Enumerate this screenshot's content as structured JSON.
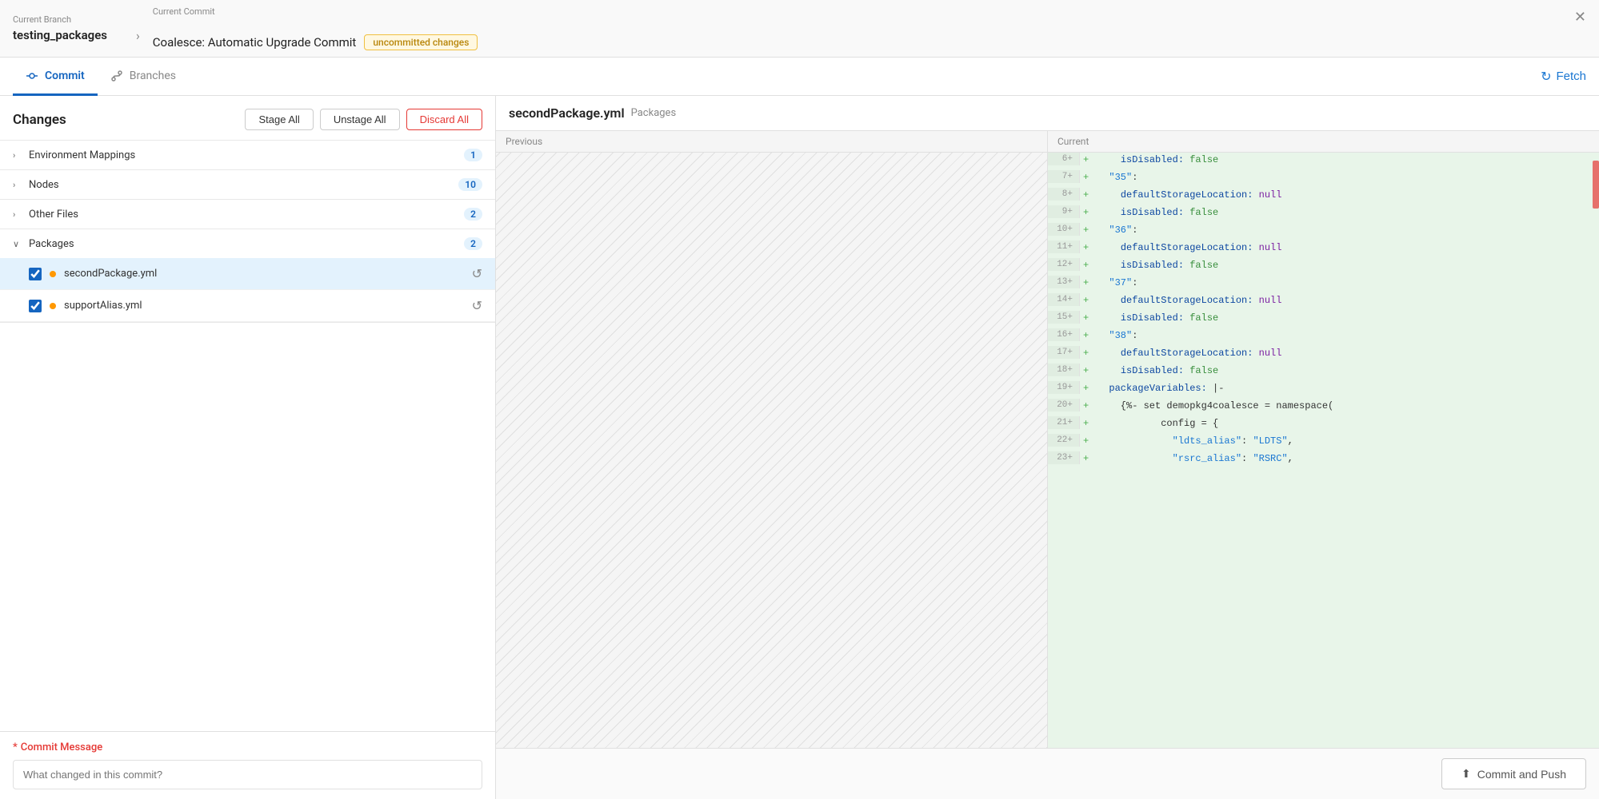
{
  "header": {
    "branch_label": "Current Branch",
    "branch_name": "testing_packages",
    "commit_label": "Current Commit",
    "commit_name": "Coalesce: Automatic Upgrade Commit",
    "uncommitted_badge": "uncommitted changes",
    "close_icon": "✕"
  },
  "tabs": {
    "commit_label": "Commit",
    "branches_label": "Branches",
    "fetch_label": "Fetch"
  },
  "changes": {
    "title": "Changes",
    "stage_all": "Stage All",
    "unstage_all": "Unstage All",
    "discard_all": "Discard All",
    "groups": [
      {
        "name": "Environment Mappings",
        "count": 1,
        "expanded": false,
        "items": []
      },
      {
        "name": "Nodes",
        "count": 10,
        "expanded": false,
        "items": []
      },
      {
        "name": "Other Files",
        "count": 2,
        "expanded": false,
        "items": []
      },
      {
        "name": "Packages",
        "count": 2,
        "expanded": true,
        "items": [
          {
            "name": "secondPackage.yml",
            "checked": true,
            "selected": true
          },
          {
            "name": "supportAlias.yml",
            "checked": true,
            "selected": false
          }
        ]
      }
    ]
  },
  "commit_message": {
    "label": "Commit Message",
    "placeholder": "What changed in this commit?"
  },
  "diff": {
    "filename": "secondPackage.yml",
    "path": "Packages",
    "previous_label": "Previous",
    "current_label": "Current",
    "lines": [
      {
        "num": "6+",
        "code": "    isDisabled: false"
      },
      {
        "num": "7+",
        "code": "  \"35\":"
      },
      {
        "num": "8+",
        "code": "    defaultStorageLocation: null"
      },
      {
        "num": "9+",
        "code": "    isDisabled: false"
      },
      {
        "num": "10+",
        "code": "  \"36\":"
      },
      {
        "num": "11+",
        "code": "    defaultStorageLocation: null"
      },
      {
        "num": "12+",
        "code": "    isDisabled: false"
      },
      {
        "num": "13+",
        "code": "  \"37\":"
      },
      {
        "num": "14+",
        "code": "    defaultStorageLocation: null"
      },
      {
        "num": "15+",
        "code": "    isDisabled: false"
      },
      {
        "num": "16+",
        "code": "  \"38\":"
      },
      {
        "num": "17+",
        "code": "    defaultStorageLocation: null"
      },
      {
        "num": "18+",
        "code": "    isDisabled: false"
      },
      {
        "num": "19+",
        "code": "  packageVariables: |-"
      },
      {
        "num": "20+",
        "code": "    {%- set demopkg4coalesce = namespace("
      },
      {
        "num": "21+",
        "code": "           config = {"
      },
      {
        "num": "22+",
        "code": "             \"ldts_alias\": \"LDTS\","
      },
      {
        "num": "23+",
        "code": "             \"rsrc_alias\": \"RSRC\","
      }
    ]
  },
  "bottom": {
    "commit_push_label": "Commit and Push",
    "upload_icon": "⬆"
  }
}
